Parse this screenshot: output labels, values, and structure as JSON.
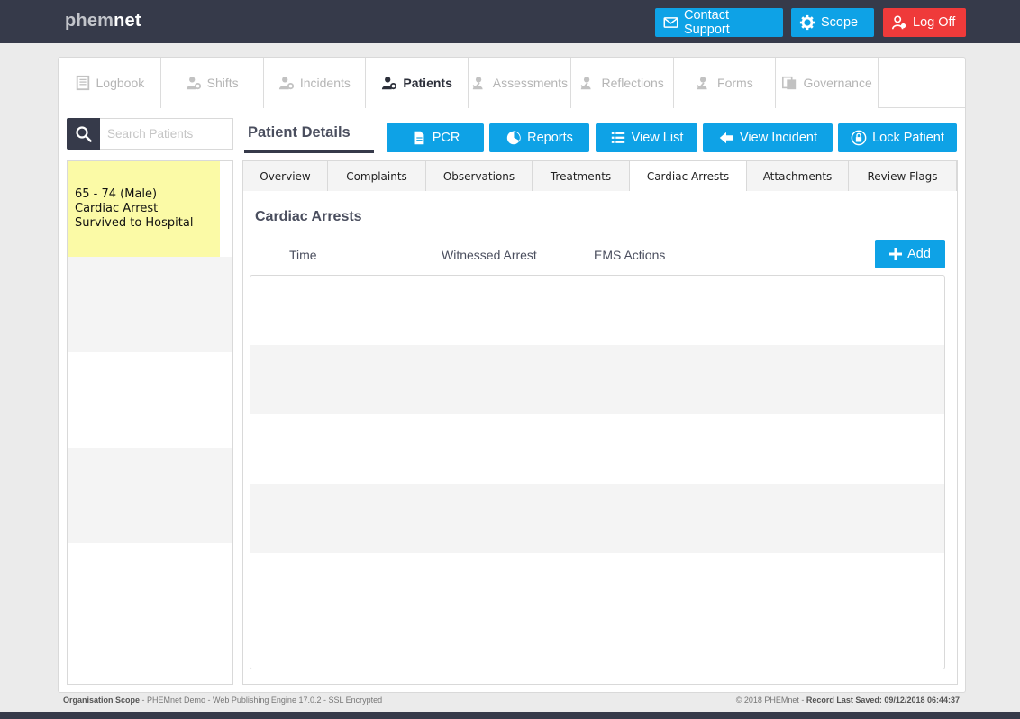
{
  "header": {
    "logo_light": "phem",
    "logo_bold": "net",
    "contact_support": "Contact Support",
    "scope": "Scope",
    "log_off": "Log Off"
  },
  "nav": {
    "tabs": [
      {
        "label": "Logbook",
        "icon": "book-icon"
      },
      {
        "label": "Shifts",
        "icon": "user-gear-icon"
      },
      {
        "label": "Incidents",
        "icon": "user-gear-icon"
      },
      {
        "label": "Patients",
        "icon": "user-gear-icon",
        "active": true
      },
      {
        "label": "Assessments",
        "icon": "user-check-icon"
      },
      {
        "label": "Reflections",
        "icon": "user-check-icon"
      },
      {
        "label": "Forms",
        "icon": "user-check-icon"
      },
      {
        "label": "Governance",
        "icon": "documents-icon"
      }
    ]
  },
  "search": {
    "placeholder": "Search Patients"
  },
  "patients": {
    "selected": {
      "line1": "65 - 74 (Male)",
      "line2": "Cardiac Arrest",
      "line3": "Survived to Hospital"
    }
  },
  "details": {
    "title": "Patient Details",
    "actions": {
      "pcr": "PCR",
      "reports": "Reports",
      "view_list": "View List",
      "view_incident": "View Incident",
      "lock_patient": "Lock Patient"
    },
    "subtabs": [
      "Overview",
      "Complaints",
      "Observations",
      "Treatments",
      "Cardiac Arrests",
      "Attachments",
      "Review Flags"
    ],
    "active_subtab": "Cardiac Arrests",
    "section_title": "Cardiac Arrests",
    "columns": {
      "time": "Time",
      "witnessed": "Witnessed Arrest",
      "ems": "EMS Actions"
    },
    "add": "Add"
  },
  "footer": {
    "left_bold": "Organisation Scope",
    "left_rest": " - PHEMnet Demo - Web Publishing Engine 17.0.2 - SSL Encrypted",
    "right_plain": "© 2018 PHEMnet - ",
    "right_bold": "Record Last Saved: 09/12/2018 06:44:37"
  },
  "colors": {
    "header_bg": "#363a4a",
    "accent_blue": "#0ea2e6",
    "danger_red": "#ef3a3a",
    "selected_patient": "#fbfaa6"
  }
}
